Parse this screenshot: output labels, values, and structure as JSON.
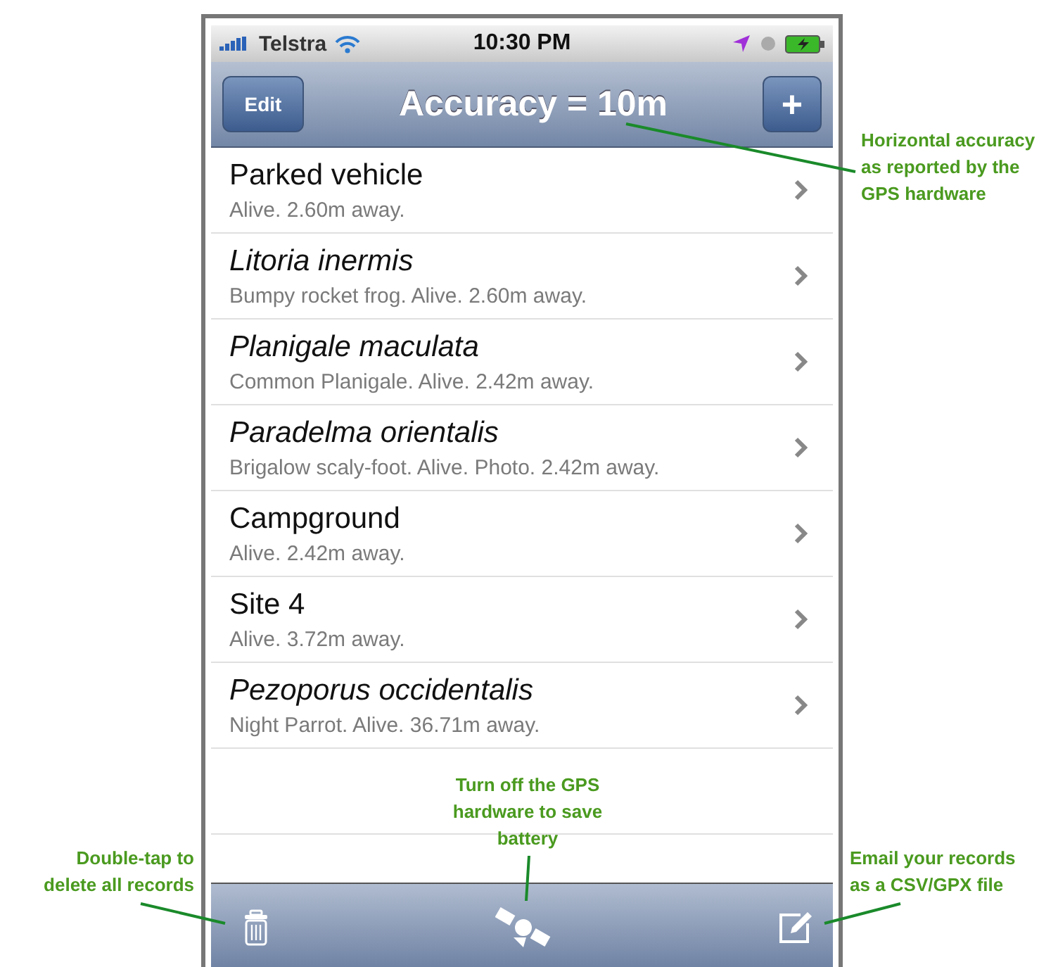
{
  "status_bar": {
    "carrier": "Telstra",
    "time": "10:30 PM"
  },
  "nav_bar": {
    "edit_button": "Edit",
    "title": "Accuracy = 10m",
    "add_button": "+"
  },
  "records": [
    {
      "title": "Parked vehicle",
      "subtitle": "Alive. 2.60m away.",
      "kind": "place"
    },
    {
      "title": "Litoria inermis",
      "subtitle": "Bumpy rocket frog. Alive. 2.60m away.",
      "kind": "species"
    },
    {
      "title": "Planigale maculata",
      "subtitle": "Common Planigale. Alive. 2.42m away.",
      "kind": "species"
    },
    {
      "title": "Paradelma orientalis",
      "subtitle": "Brigalow scaly-foot. Alive. Photo. 2.42m away.",
      "kind": "species"
    },
    {
      "title": "Campground",
      "subtitle": "Alive. 2.42m away.",
      "kind": "place"
    },
    {
      "title": "Site 4",
      "subtitle": "Alive. 3.72m away.",
      "kind": "place"
    },
    {
      "title": "Pezoporus occidentalis",
      "subtitle": "Night Parrot. Alive. 36.71m away.",
      "kind": "species"
    }
  ],
  "annotations": [
    {
      "kind": "accuracy",
      "lines": [
        "Horizontal accuracy",
        "as reported by the",
        "GPS hardware"
      ]
    },
    {
      "kind": "gps",
      "lines": [
        "Turn off the GPS",
        "hardware to save",
        "battery"
      ]
    },
    {
      "kind": "trash",
      "lines": [
        "Double-tap to",
        "delete all records"
      ]
    },
    {
      "kind": "email",
      "lines": [
        "Email your records",
        "as a CSV/GPX file"
      ]
    }
  ]
}
